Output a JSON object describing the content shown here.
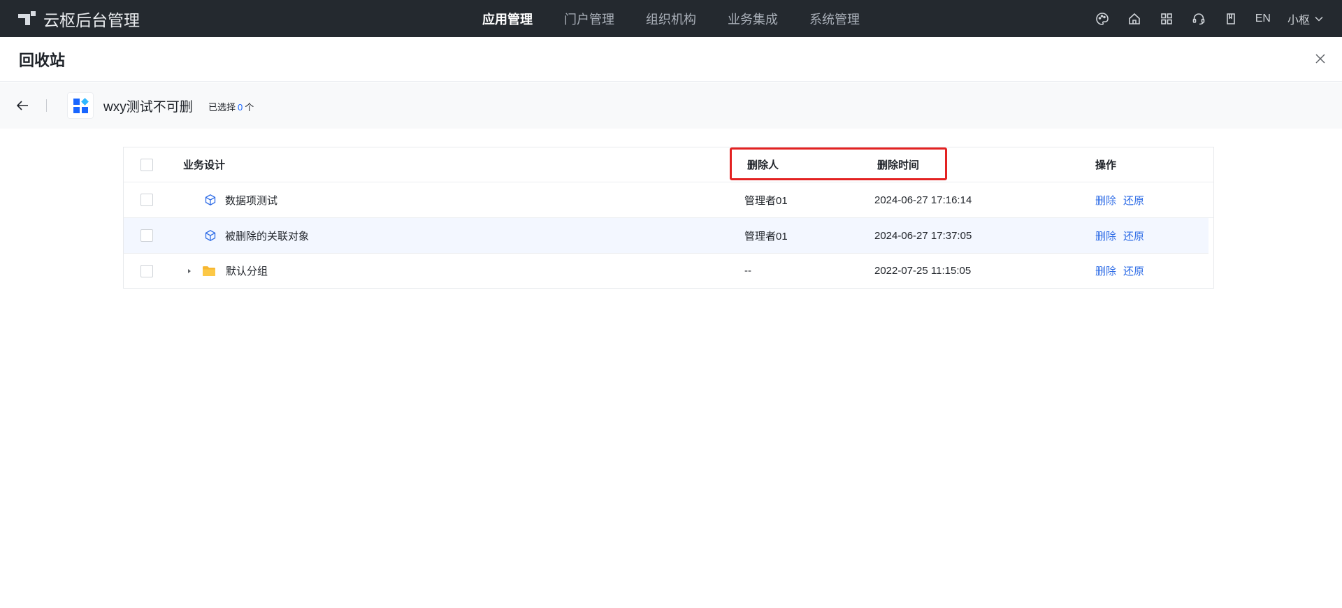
{
  "app": {
    "brand": "云枢后台管理",
    "nav": [
      "应用管理",
      "门户管理",
      "组织机构",
      "业务集成",
      "系统管理"
    ],
    "active_nav": 0,
    "lang": "EN",
    "user": "小枢"
  },
  "page": {
    "title": "回收站"
  },
  "sub_header": {
    "app_name": "wxy测试不可删",
    "selected_prefix": "已选择",
    "selected_count": "0",
    "selected_suffix": "个"
  },
  "table": {
    "columns": {
      "name": "业务设计",
      "deleter": "删除人",
      "time": "删除时间",
      "ops": "操作"
    },
    "rows": [
      {
        "name": "数据项测试",
        "type": "model",
        "deleter": "管理者01",
        "time": "2024-06-27 17:16:14"
      },
      {
        "name": "被删除的关联对象",
        "type": "model",
        "deleter": "管理者01",
        "time": "2024-06-27 17:37:05"
      },
      {
        "name": "默认分组",
        "type": "folder",
        "deleter": "--",
        "time": "2022-07-25 11:15:05"
      }
    ],
    "op_delete": "删除",
    "op_restore": "还原"
  },
  "colors": {
    "topbar": "#24292f",
    "accent": "#2e6ce6",
    "highlight_box": "#e32222",
    "folder": "#f7b731"
  }
}
